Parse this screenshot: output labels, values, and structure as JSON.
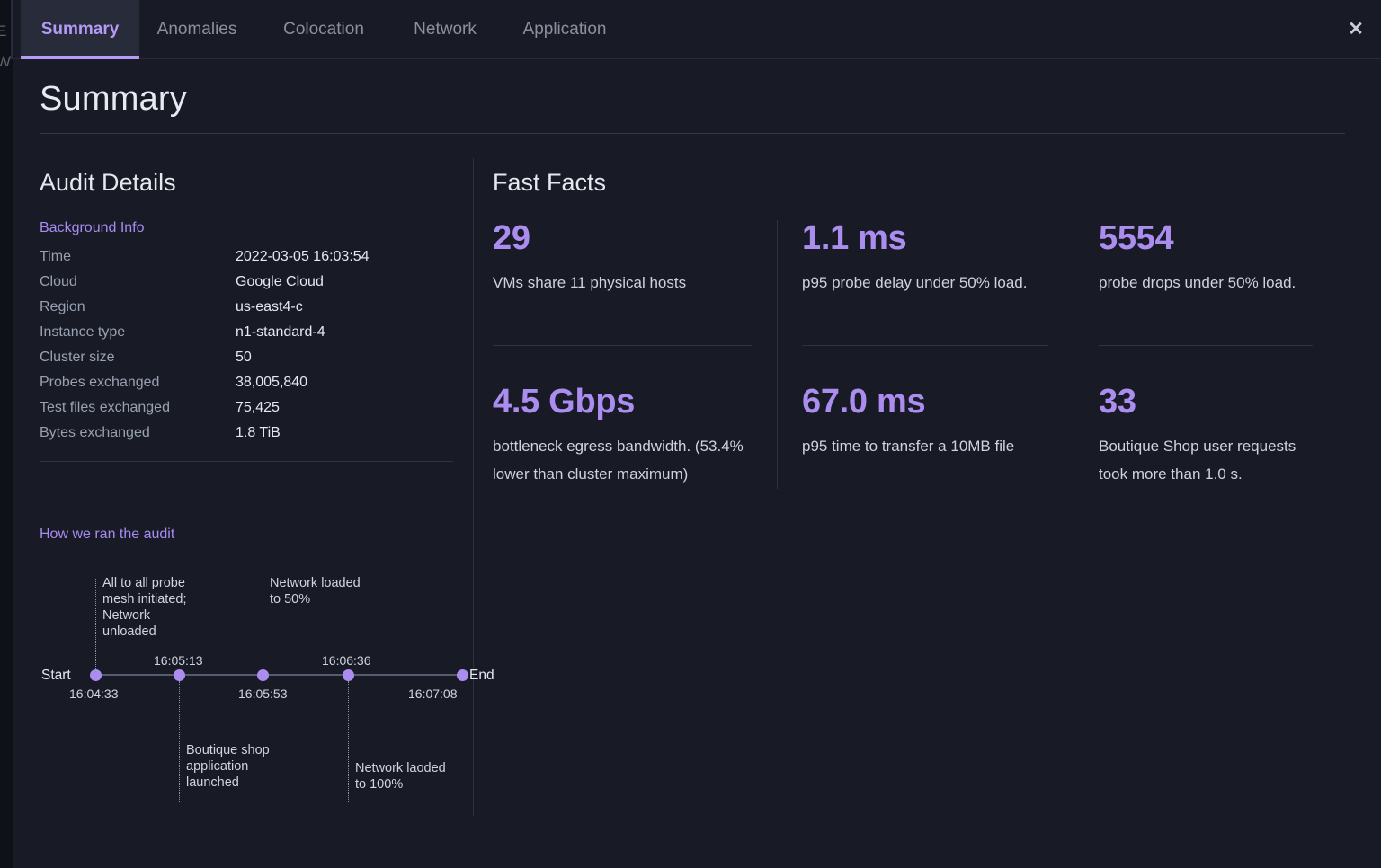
{
  "colors": {
    "accent": "#ab8df0",
    "modal_bg": "#181b26",
    "page_bg": "#0e1117",
    "text": "#e4e8ef",
    "muted": "#99a0b0",
    "divider": "#2d3242"
  },
  "background": {
    "left_glyphs": "E\nW",
    "right_strip_color": "#1f6feb"
  },
  "tabs": [
    {
      "label": "Summary",
      "active": true
    },
    {
      "label": "Anomalies",
      "active": false
    },
    {
      "label": "Colocation",
      "active": false
    },
    {
      "label": "Network",
      "active": false
    },
    {
      "label": "Application",
      "active": false
    }
  ],
  "close_label": "✕",
  "page_title": "Summary",
  "audit": {
    "heading": "Audit Details",
    "background_info_link": "Background Info",
    "rows": [
      {
        "key": "Time",
        "value": "2022-03-05 16:03:54"
      },
      {
        "key": "Cloud",
        "value": "Google Cloud"
      },
      {
        "key": "Region",
        "value": "us-east4-c"
      },
      {
        "key": "Instance type",
        "value": "n1-standard-4"
      },
      {
        "key": "Cluster size",
        "value": "50"
      },
      {
        "key": "Probes exchanged",
        "value": "38,005,840"
      },
      {
        "key": "Test files exchanged",
        "value": "75,425"
      },
      {
        "key": "Bytes exchanged",
        "value": "1.8 TiB"
      }
    ]
  },
  "timeline": {
    "heading": "How we ran the audit",
    "start_cap": "Start",
    "end_cap": "End",
    "points": [
      {
        "time": "16:04:33",
        "time_pos": "below",
        "note": "All to all probe\nmesh initiated;\nNetwork\nunloaded",
        "note_pos": "above"
      },
      {
        "time": "16:05:13",
        "time_pos": "above",
        "note": "Boutique shop\napplication\nlaunched",
        "note_pos": "below"
      },
      {
        "time": "16:05:53",
        "time_pos": "below",
        "note": "Network loaded\nto 50%",
        "note_pos": "above"
      },
      {
        "time": "16:06:36",
        "time_pos": "above",
        "note": "Network laoded\nto 100%",
        "note_pos": "below"
      },
      {
        "time": "16:07:08",
        "time_pos": "below",
        "note": "",
        "note_pos": "none"
      }
    ]
  },
  "fast_facts": {
    "heading": "Fast Facts",
    "items": [
      {
        "value": "29",
        "desc": "VMs share 11 physical hosts"
      },
      {
        "value": "1.1 ms",
        "desc": "p95 probe delay under 50% load."
      },
      {
        "value": "5554",
        "desc": "probe drops under 50% load."
      },
      {
        "value": "4.5 Gbps",
        "desc": "bottleneck egress bandwidth. (53.4% lower than cluster maximum)"
      },
      {
        "value": "67.0 ms",
        "desc": "p95 time to transfer a 10MB file"
      },
      {
        "value": "33",
        "desc": "Boutique Shop user requests took more than 1.0 s."
      }
    ]
  }
}
